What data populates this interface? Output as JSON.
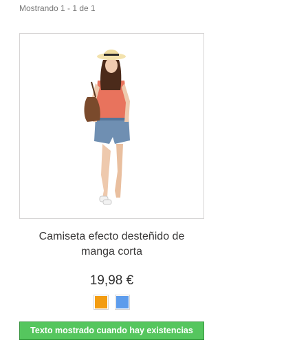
{
  "listing": {
    "results_text": "Mostrando 1 - 1 de 1"
  },
  "product": {
    "name": "Camiseta efecto desteñido de manga corta",
    "price": "19,98 €",
    "colors": [
      {
        "name": "orange",
        "hex": "#f39c11"
      },
      {
        "name": "blue",
        "hex": "#5d9cec"
      }
    ],
    "availability": "Texto mostrado cuando hay existencias",
    "availability_color": "#55c65e"
  }
}
